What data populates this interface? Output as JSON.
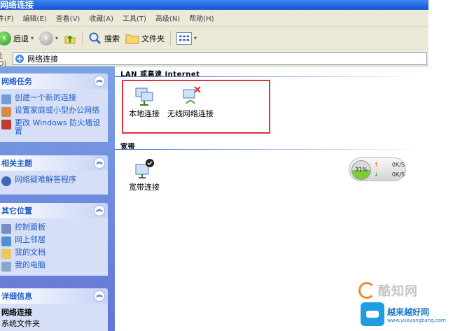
{
  "window": {
    "title": "网络连接"
  },
  "menu": [
    "件(F)",
    "编辑(E)",
    "查看(V)",
    "收藏(A)",
    "工具(T)",
    "高级(N)",
    "帮助(H)"
  ],
  "toolbar": {
    "back_label": "后退",
    "search_label": "搜索",
    "folders_label": "文件夹"
  },
  "address": {
    "label": "址(D)",
    "value": "网络连接"
  },
  "left": {
    "network_tasks": {
      "title": "网络任务",
      "items": [
        "创建一个新的连接",
        "设置家庭或小型办公网络",
        "更改 Windows 防火墙设置"
      ]
    },
    "related": {
      "title": "相关主题",
      "items": [
        "网络疑难解答程序"
      ]
    },
    "other": {
      "title": "其它位置",
      "items": [
        "控制面板",
        "网上邻居",
        "我的文档",
        "我的电脑"
      ]
    },
    "details": {
      "title": "详细信息",
      "name": "网络连接",
      "type": "系统文件夹"
    }
  },
  "groups": {
    "lan": {
      "title": "LAN 或高速 Internet",
      "items": [
        "本地连接",
        "无线网络连接"
      ]
    },
    "broadband": {
      "title": "宽带",
      "items": [
        "宽带连接"
      ]
    }
  },
  "speed_widget": {
    "percent": "31%",
    "up": "0K/S",
    "down": "0K/S"
  },
  "watermark": {
    "brand1": "酷知网",
    "brand2": "越来越好网",
    "url": "www.yueyangbang.com"
  },
  "colors": {
    "accent": "#215dc6",
    "highlight_box": "#e0323a",
    "titlebar": "#1553d4"
  }
}
